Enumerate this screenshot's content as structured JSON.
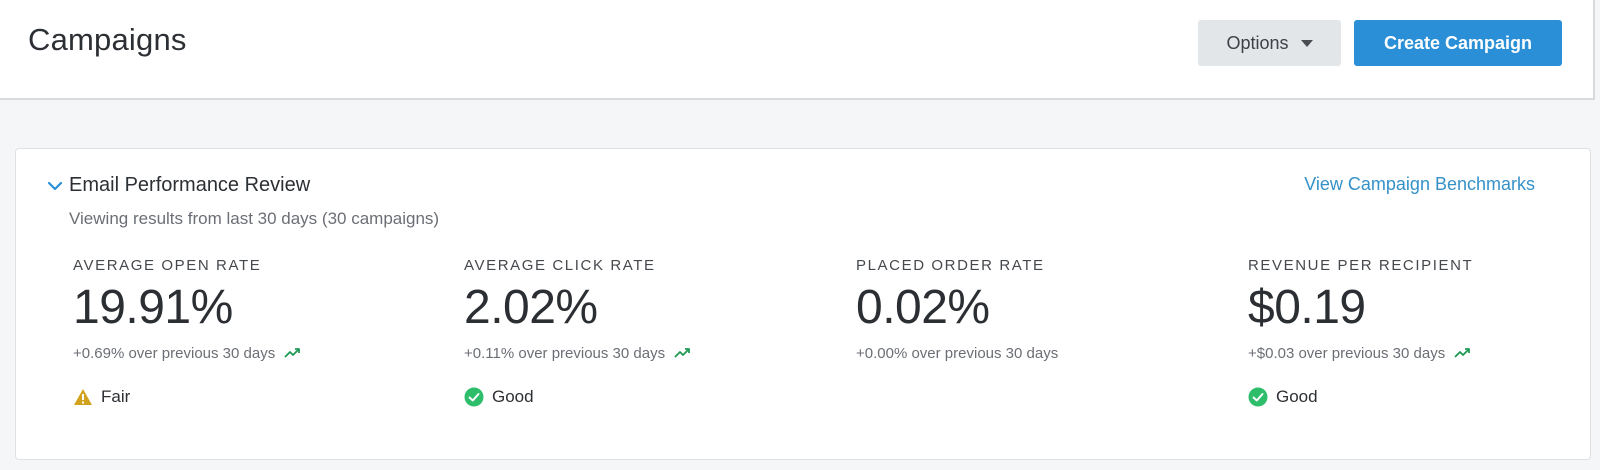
{
  "header": {
    "title": "Campaigns",
    "options_label": "Options",
    "create_label": "Create Campaign",
    "create_color": "#2a8fd6"
  },
  "review": {
    "title": "Email Performance Review",
    "subtitle": "Viewing results from last 30 days (30 campaigns)",
    "benchmarks_link": "View Campaign Benchmarks",
    "metrics": [
      {
        "label": "AVERAGE OPEN RATE",
        "value": "19.91%",
        "delta": "+0.69% over previous 30 days",
        "trend_icon": "trending-up-icon",
        "status": "Fair",
        "status_icon": "warning-icon",
        "status_color": "#d1a21b"
      },
      {
        "label": "AVERAGE CLICK RATE",
        "value": "2.02%",
        "delta": "+0.11% over previous 30 days",
        "trend_icon": "trending-up-icon",
        "status": "Good",
        "status_icon": "check-circle-icon",
        "status_color": "#2ebd6b"
      },
      {
        "label": "PLACED ORDER RATE",
        "value": "0.02%",
        "delta": "+0.00% over previous 30 days"
      },
      {
        "label": "REVENUE PER RECIPIENT",
        "value": "$0.19",
        "delta": "+$0.03 over previous 30 days",
        "trend_icon": "trending-up-icon",
        "status": "Good",
        "status_icon": "check-circle-icon",
        "status_color": "#2ebd6b"
      }
    ]
  }
}
